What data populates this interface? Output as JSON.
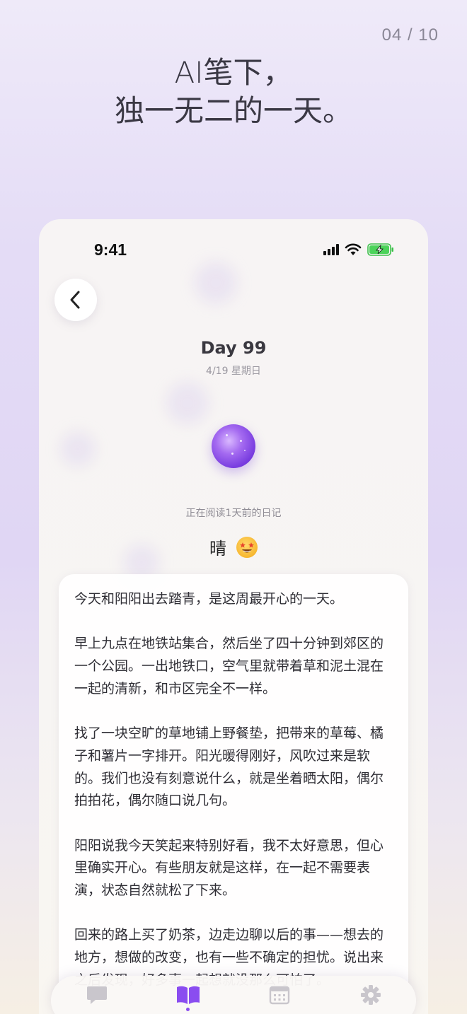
{
  "page_counter": "04 / 10",
  "hero": {
    "line1": "AI笔下，",
    "line2": "独一无二的一天。"
  },
  "status_bar": {
    "time": "9:41"
  },
  "diary": {
    "day_title": "Day 99",
    "date": "4/19 星期日",
    "reading_note": "正在阅读1天前的日记",
    "weather": "晴",
    "mood_icon": "star-struck-emoji",
    "paragraphs": [
      "今天和阳阳出去踏青，是这周最开心的一天。",
      "早上九点在地铁站集合，然后坐了四十分钟到郊区的一个公园。一出地铁口，空气里就带着草和泥土混在一起的清新，和市区完全不一样。",
      "找了一块空旷的草地铺上野餐垫，把带来的草莓、橘子和薯片一字排开。阳光暖得刚好，风吹过来是软的。我们也没有刻意说什么，就是坐着晒太阳，偶尔拍拍花，偶尔随口说几句。",
      "阳阳说我今天笑起来特别好看，我不太好意思，但心里确实开心。有些朋友就是这样，在一起不需要表演，状态自然就松了下来。",
      "回来的路上买了奶茶，边走边聊以后的事——想去的地方，想做的改变，也有一些不确定的担忧。说出来之后发现，好多事一起想就没那么可怕了。"
    ]
  },
  "tab_bar": {
    "tabs": [
      {
        "icon": "chat-bubble-icon",
        "active": false
      },
      {
        "icon": "open-book-icon",
        "active": true
      },
      {
        "icon": "calendar-icon",
        "active": false
      },
      {
        "icon": "gear-icon",
        "active": false
      }
    ]
  },
  "colors": {
    "accent": "#8a4df0",
    "inactive_icon": "#c9c6cc",
    "text": "#2f2e35"
  }
}
